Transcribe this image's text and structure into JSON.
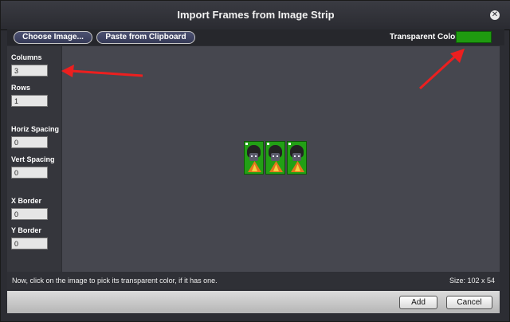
{
  "window": {
    "title": "Import Frames from Image Strip"
  },
  "toolbar": {
    "choose_image_label": "Choose Image...",
    "paste_label": "Paste from Clipboard",
    "transparent_color_label": "Transparent Color",
    "transparent_color": "#1f9a10"
  },
  "settings": {
    "columns": {
      "label": "Columns",
      "value": "3"
    },
    "rows": {
      "label": "Rows",
      "value": "1"
    },
    "horiz_spacing": {
      "label": "Horiz Spacing",
      "value": "0"
    },
    "vert_spacing": {
      "label": "Vert Spacing",
      "value": "0"
    },
    "x_border": {
      "label": "X Border",
      "value": "0"
    },
    "y_border": {
      "label": "Y Border",
      "value": "0"
    }
  },
  "status": {
    "hint": "Now, click on the image to pick its transparent color, if it has one.",
    "size": "Size: 102 x 54"
  },
  "footer": {
    "add_label": "Add",
    "cancel_label": "Cancel"
  },
  "icons": {
    "close": "close-icon",
    "annotation": "arrow-icon"
  }
}
